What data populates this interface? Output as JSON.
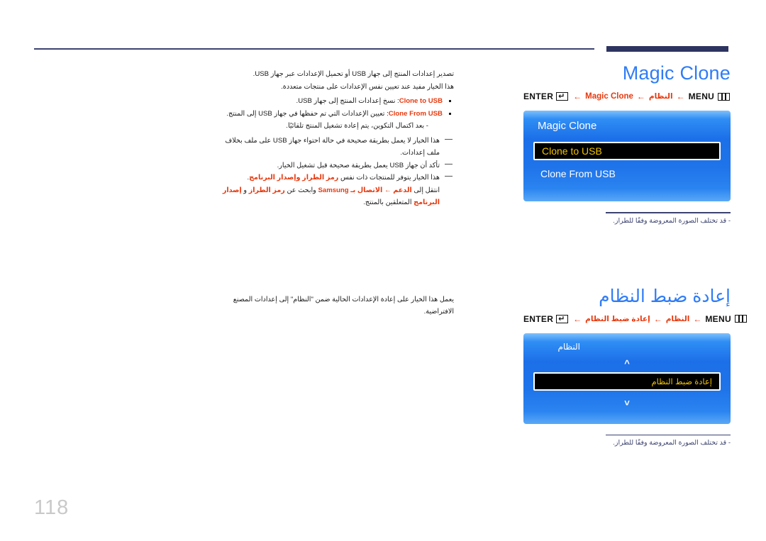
{
  "page": {
    "number": "118"
  },
  "colors": {
    "heading_blue": "#2f7cf6",
    "keyword_red": "#e8380d",
    "rule_navy": "#3c4370",
    "osd_blue": "#1f74ea",
    "selected_yellow": "#f2c200"
  },
  "sections": [
    {
      "title": "Magic Clone",
      "title_is_arabic": false,
      "breadcrumb": {
        "menu_label": "MENU",
        "menu_icon": "menu-icon",
        "enter_label": "ENTER",
        "enter_icon": "enter-icon",
        "arrow": "←",
        "crumbs": [
          "النظام",
          "Magic Clone"
        ]
      },
      "osd": {
        "header": "Magic Clone",
        "header_is_arabic": false,
        "rows": [
          {
            "label": "Clone to USB",
            "selected": true
          },
          {
            "label": "Clone From USB",
            "selected": false
          }
        ],
        "chevron_up": "",
        "chevron_down": ""
      },
      "caption": "‑ قد تختلف الصورة المعروضة وفقًا للطراز."
    },
    {
      "title": "إعادة ضبط النظام",
      "title_is_arabic": true,
      "breadcrumb": {
        "menu_label": "MENU",
        "menu_icon": "menu-icon",
        "enter_label": "ENTER",
        "enter_icon": "enter-icon",
        "arrow": "←",
        "crumbs": [
          "النظام",
          "إعادة ضبط النظام"
        ]
      },
      "osd": {
        "header": "النظام",
        "header_is_arabic": true,
        "rows": [
          {
            "label": "إعادة ضبط النظام",
            "selected": true
          }
        ],
        "chevron_up": "⌃",
        "chevron_down": "⌄"
      },
      "caption": "‑ قد تختلف الصورة المعروضة وفقًا للطراز."
    }
  ],
  "body": {
    "magic_clone": {
      "intro_line_1": "تصدير إعدادات المنتج إلى جهاز USB أو تحميل الإعدادات عبر جهاز USB.",
      "intro_line_2": "هذا الخيار مفيد عند تعيين نفس الإعدادات على منتجات متعددة.",
      "bullets": [
        {
          "term": "Clone to USB",
          "text": ": نسخ إعدادات المنتج إلى جهاز USB."
        },
        {
          "term": "Clone From USB",
          "text": ": تعيين الإعدادات التي تم حفظها في جهاز USB إلى المنتج.",
          "sub": "‑ بعد اكتمال التكوين، يتم إعادة تشغيل المنتج تلقائيًا."
        }
      ],
      "notes": [
        "هذا الخيار لا يعمل بطريقة صحيحة في حالة احتواء جهاز USB على ملف بخلاف ملف إعدادات.",
        "تأكد أن جهاز USB يعمل بطريقة صحيحة قبل تشغيل الخيار.",
        "هذا الخيار يتوفر للمنتجات ذات نفس رمز الطراز وإصدار البرنامج."
      ],
      "note_keywords_3": "رمز الطراز وإصدار البرنامج",
      "final_line": {
        "prefix": "انتقل إلى ",
        "kw1": "الدعم",
        "arrow": " ← ",
        "kw2": "الاتصال بـ Samsung",
        "mid": " وابحث عن ",
        "kw3": "رمز الطراز",
        "and": " و ",
        "kw4": "إصدار البرنامج",
        "suffix": " المتعلقين بالمنتج."
      }
    },
    "reset_system": {
      "paragraph": "يعمل هذا الخيار على إعادة الإعدادات الحالية ضمن \"النظام\" إلى إعدادات المصنع الافتراضية."
    }
  }
}
